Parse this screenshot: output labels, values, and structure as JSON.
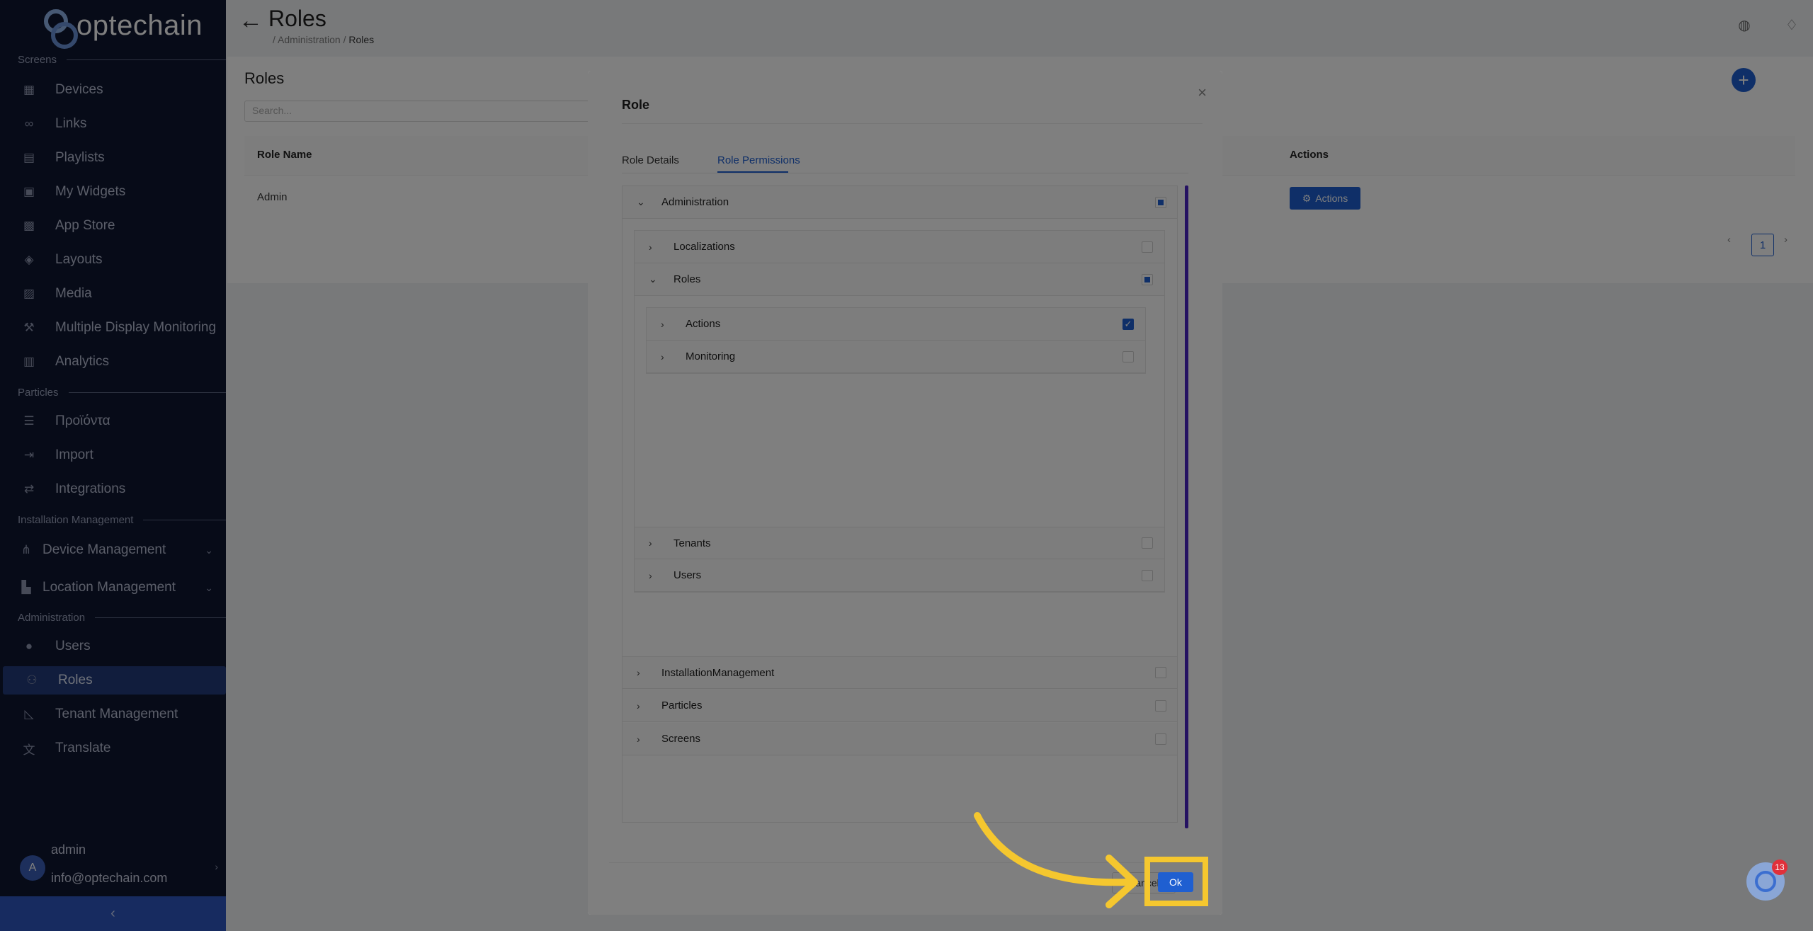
{
  "brand": {
    "name": "optechain"
  },
  "sidebar": {
    "sections": [
      "Screens",
      "Particles",
      "Installation Management",
      "Administration"
    ],
    "screens_items": [
      {
        "label": "Devices",
        "icon": "grid-icon"
      },
      {
        "label": "Links",
        "icon": "link-icon"
      },
      {
        "label": "Playlists",
        "icon": "playlist-icon"
      },
      {
        "label": "My Widgets",
        "icon": "widgets-icon"
      },
      {
        "label": "App Store",
        "icon": "appstore-icon"
      },
      {
        "label": "Layouts",
        "icon": "layers-icon"
      },
      {
        "label": "Media",
        "icon": "image-icon"
      },
      {
        "label": "Multiple Display Monitoring",
        "icon": "monitor-icon"
      },
      {
        "label": "Analytics",
        "icon": "chart-icon"
      }
    ],
    "particles_items": [
      {
        "label": "Προϊόντα",
        "icon": "list-icon"
      },
      {
        "label": "Import",
        "icon": "import-icon"
      },
      {
        "label": "Integrations",
        "icon": "swap-icon"
      }
    ],
    "installation_items": [
      {
        "label": "Device Management",
        "icon": "network-icon"
      },
      {
        "label": "Location Management",
        "icon": "building-icon"
      }
    ],
    "admin_items": [
      {
        "label": "Users",
        "icon": "user-icon"
      },
      {
        "label": "Roles",
        "icon": "users-icon"
      },
      {
        "label": "Tenant Management",
        "icon": "tenant-icon"
      },
      {
        "label": "Translate",
        "icon": "translate-icon"
      }
    ],
    "user": {
      "avatar": "A",
      "name": "admin",
      "email": "info@optechain.com"
    }
  },
  "header": {
    "title": "Roles",
    "breadcrumb": [
      "Administration",
      "Roles"
    ]
  },
  "content": {
    "heading": "Roles",
    "search_placeholder": "Search...",
    "columns": [
      "Role Name",
      "Actions"
    ],
    "rows": [
      {
        "name": "Admin",
        "action": "Actions"
      }
    ],
    "page": "1"
  },
  "modal": {
    "title": "Role",
    "tabs": [
      "Role Details",
      "Role Permissions"
    ],
    "active_tab": "Role Permissions",
    "tree": {
      "administration": "Administration",
      "localizations": "Localizations",
      "roles": "Roles",
      "actions": "Actions",
      "monitoring": "Monitoring",
      "tenants": "Tenants",
      "users": "Users",
      "installation": "InstallationManagement",
      "particles": "Particles",
      "screens": "Screens"
    },
    "cancel_label": "Cancel",
    "ok_label": "Ok"
  },
  "help_badge": "13",
  "colors": {
    "accent": "#1f5fd1",
    "highlight": "#f5c72f",
    "sidebar": "#0f1731"
  }
}
